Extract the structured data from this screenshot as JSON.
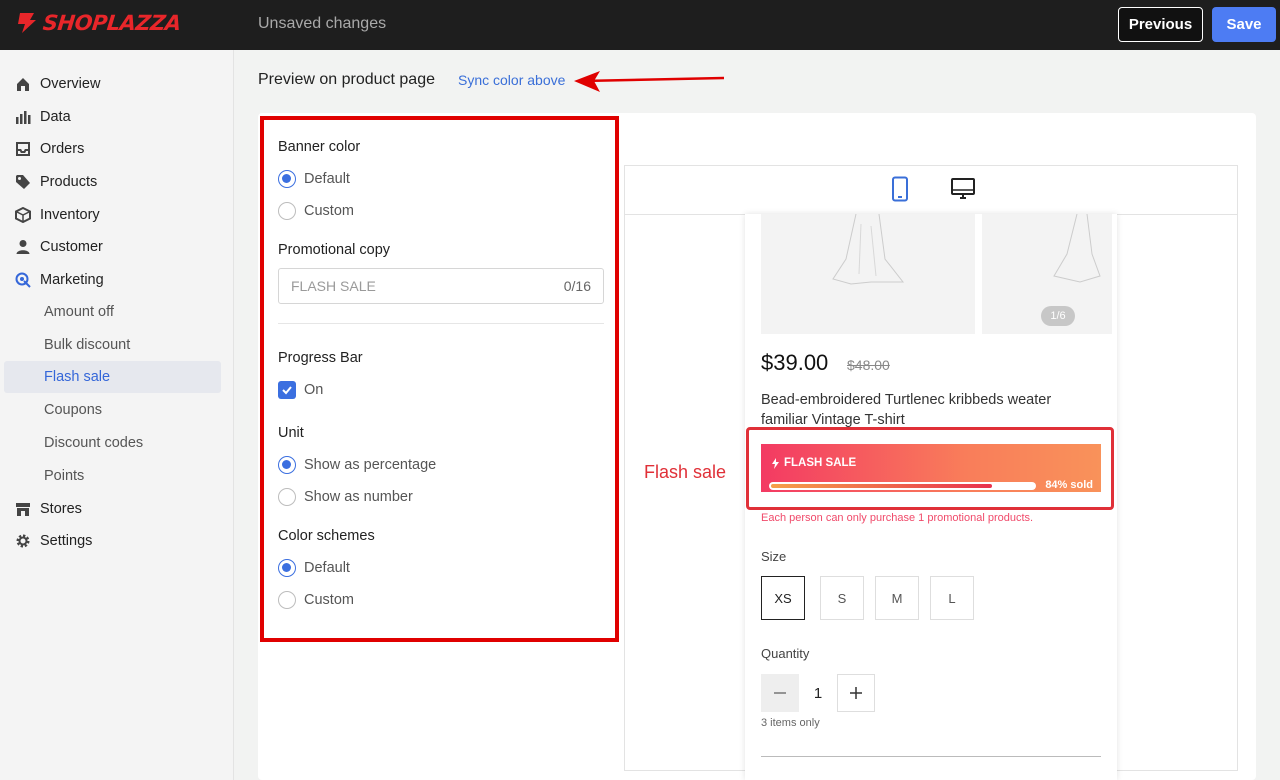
{
  "topbar": {
    "logo_text": "SHOPLAZZA",
    "status": "Unsaved changes",
    "previous_label": "Previous",
    "save_label": "Save"
  },
  "sidebar": {
    "items": [
      {
        "label": "Overview",
        "icon": "home-icon"
      },
      {
        "label": "Data",
        "icon": "bar-chart-icon"
      },
      {
        "label": "Orders",
        "icon": "inbox-icon"
      },
      {
        "label": "Products",
        "icon": "tag-icon"
      },
      {
        "label": "Inventory",
        "icon": "box-icon"
      },
      {
        "label": "Customer",
        "icon": "person-icon"
      },
      {
        "label": "Marketing",
        "icon": "marketing-icon"
      }
    ],
    "marketing_sub": [
      "Amount off",
      "Bulk discount",
      "Flash sale",
      "Coupons",
      "Discount codes",
      "Points"
    ],
    "active_sub": "Flash sale",
    "bottom_items": [
      {
        "label": "Stores",
        "icon": "store-icon"
      },
      {
        "label": "Settings",
        "icon": "gear-icon"
      }
    ]
  },
  "main": {
    "preview_title": "Preview on product page",
    "sync_link": "Sync color above"
  },
  "settings": {
    "banner_color": {
      "label": "Banner color",
      "options": [
        "Default",
        "Custom"
      ],
      "selected": "Default"
    },
    "promo_copy": {
      "label": "Promotional copy",
      "placeholder": "FLASH SALE",
      "counter": "0/16"
    },
    "progress_bar": {
      "label": "Progress Bar",
      "checkbox_label": "On",
      "checked": true
    },
    "unit": {
      "label": "Unit",
      "options": [
        "Show as percentage",
        "Show as number"
      ],
      "selected": "Show as percentage"
    },
    "color_schemes": {
      "label": "Color schemes",
      "options": [
        "Default",
        "Custom"
      ],
      "selected": "Default"
    }
  },
  "preview": {
    "image_counter": "1/6",
    "price": "$39.00",
    "old_price": "$48.00",
    "title": "Bead-embroidered Turtlenec kribbeds weater familiar Vintage T-shirt",
    "flash_label": "FLASH SALE",
    "sold_text": "84% sold",
    "sold_fraction": 0.84,
    "limit_note": "Each person can only purchase 1 promotional products.",
    "size_label": "Size",
    "sizes": [
      "XS",
      "S",
      "M",
      "L"
    ],
    "selected_size": "XS",
    "quantity_label": "Quantity",
    "quantity": "1",
    "stock_note": "3 items only"
  },
  "annotation": {
    "text": "Flash sale",
    "color": "#e03038"
  },
  "colors": {
    "accent": "#3b6fe0",
    "save_button": "#4d7cf3",
    "highlight_red": "#e00000"
  }
}
